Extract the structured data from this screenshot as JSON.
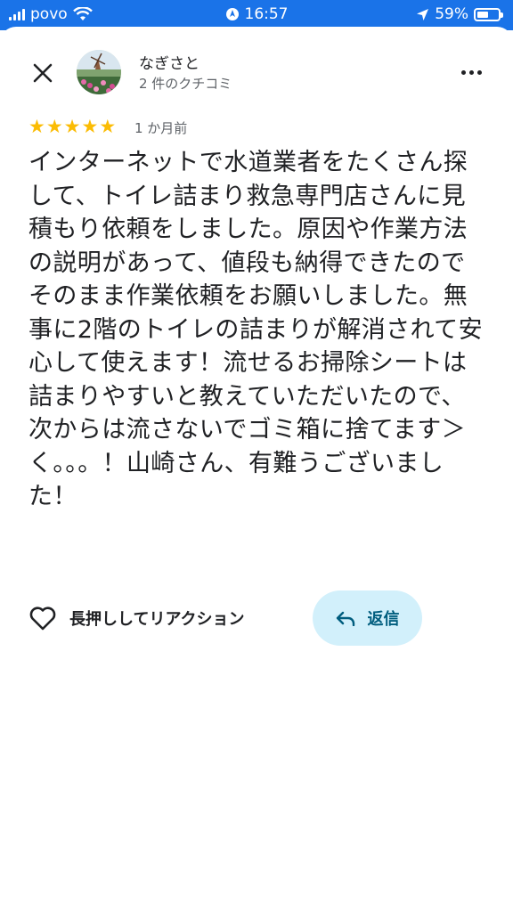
{
  "status_bar": {
    "carrier": "povo",
    "time": "16:57",
    "battery": "59%"
  },
  "reviewer": {
    "name": "なぎさと",
    "review_count": "2 件のクチコミ"
  },
  "review": {
    "rating": 5,
    "stars": [
      "★",
      "★",
      "★",
      "★",
      "★"
    ],
    "time_ago": "1 か月前",
    "text": "インターネットで水道業者をたくさん探して、トイレ詰まり救急専門店さんに見積もり依頼をしました。原因や作業方法の説明があって、値段も納得できたのでそのまま作業依頼をお願いしました。無事に2階のトイレの詰まりが解消されて安心して使えます！流せるお掃除シートは詰まりやすいと教えていただいたので、次からは流さないでゴミ箱に捨てます＞く。。。！山崎さん、有難うございました！"
  },
  "actions": {
    "like_label": "長押ししてリアクション",
    "reply_label": "返信"
  },
  "colors": {
    "status_bar": "#1a73e8",
    "star": "#fbbc04",
    "reply_bg": "#d2f0fb",
    "reply_text": "#005d7e"
  }
}
